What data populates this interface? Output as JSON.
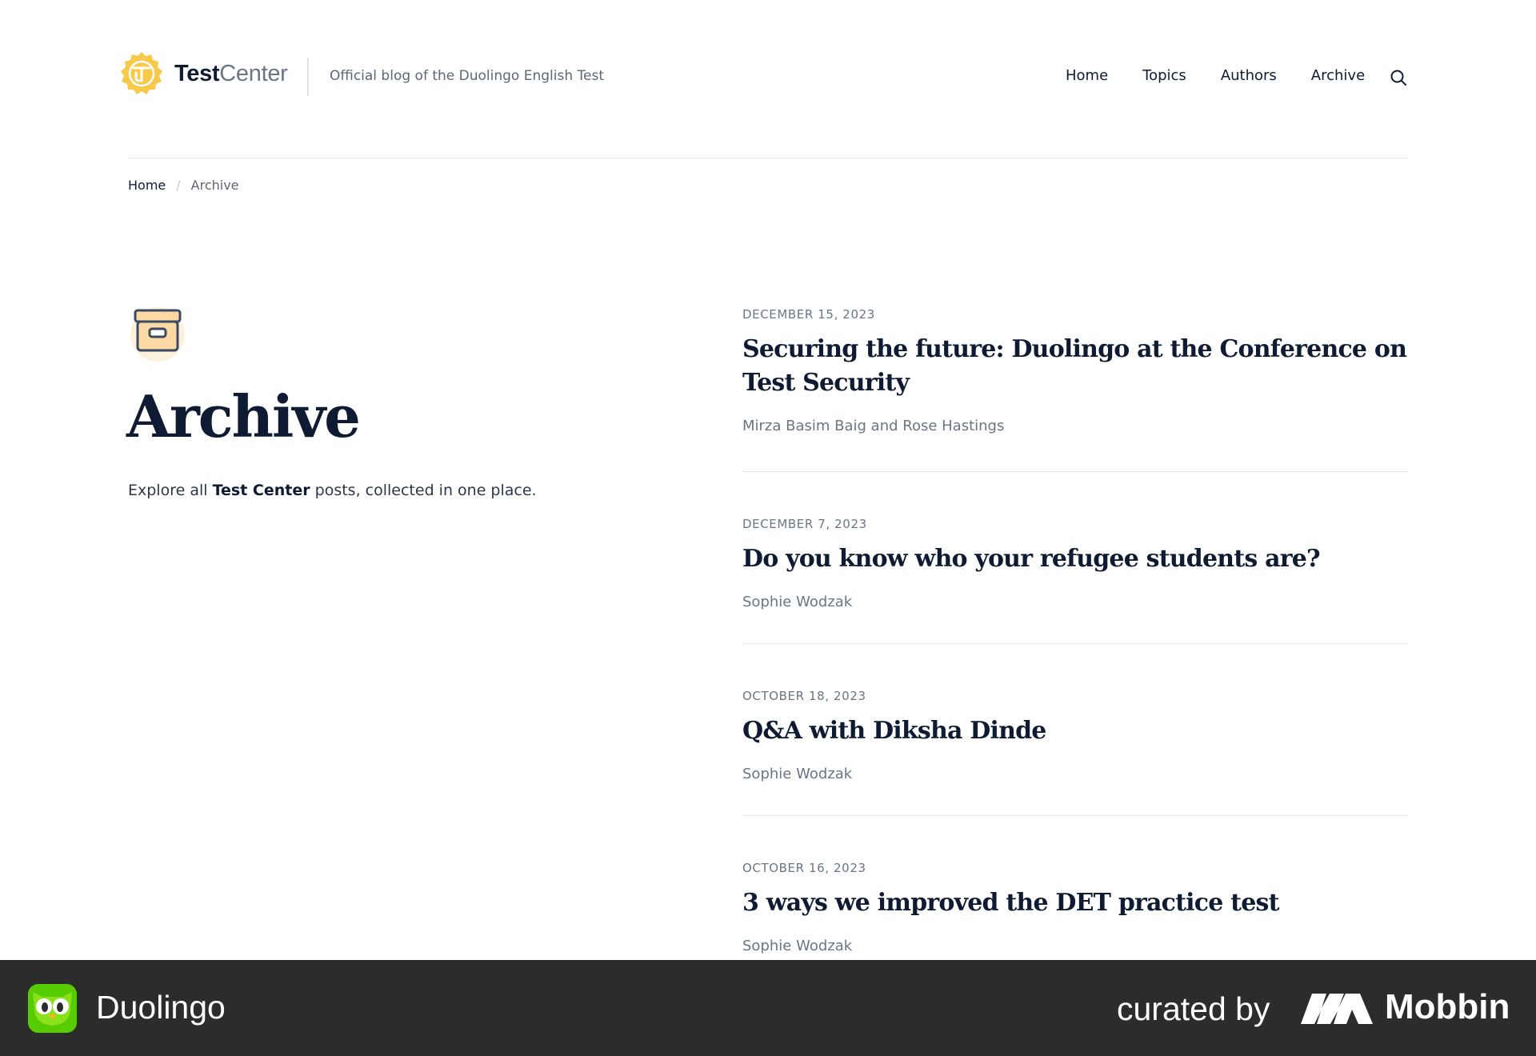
{
  "header": {
    "logo": {
      "bold": "Test",
      "light": "Center",
      "icon": "test-center-badge-icon"
    },
    "tagline": "Official blog of the Duolingo English Test",
    "nav": [
      {
        "label": "Home"
      },
      {
        "label": "Topics"
      },
      {
        "label": "Authors"
      },
      {
        "label": "Archive"
      }
    ],
    "search_icon": "search-icon"
  },
  "breadcrumb": {
    "home": "Home",
    "separator": "/",
    "current": "Archive"
  },
  "intro": {
    "icon": "archive-box-icon",
    "title": "Archive",
    "description_before": "Explore all ",
    "description_strong": "Test Center",
    "description_after": " posts, collected in one place."
  },
  "posts": [
    {
      "date": "DECEMBER 15, 2023",
      "title": "Securing the future: Duolingo at the Conference on Test Security",
      "authors": "Mirza Basim Baig and Rose Hastings"
    },
    {
      "date": "DECEMBER 7, 2023",
      "title": "Do you know who your refugee students are?",
      "authors": "Sophie Wodzak"
    },
    {
      "date": "OCTOBER 18, 2023",
      "title": "Q&A with Diksha Dinde",
      "authors": "Sophie Wodzak"
    },
    {
      "date": "OCTOBER 16, 2023",
      "title": "3 ways we improved the DET practice test",
      "authors": "Sophie Wodzak"
    }
  ],
  "bottom_bar": {
    "app_name": "Duolingo",
    "app_icon": "duolingo-owl-icon",
    "curated_by": "curated by",
    "brand": "Mobbin"
  },
  "colors": {
    "primary_text": "#0e1b33",
    "muted_text": "#6b7585",
    "badge_yellow": "#f7c948",
    "bar_background": "#2c2c2c",
    "duolingo_green": "#58cc02"
  }
}
